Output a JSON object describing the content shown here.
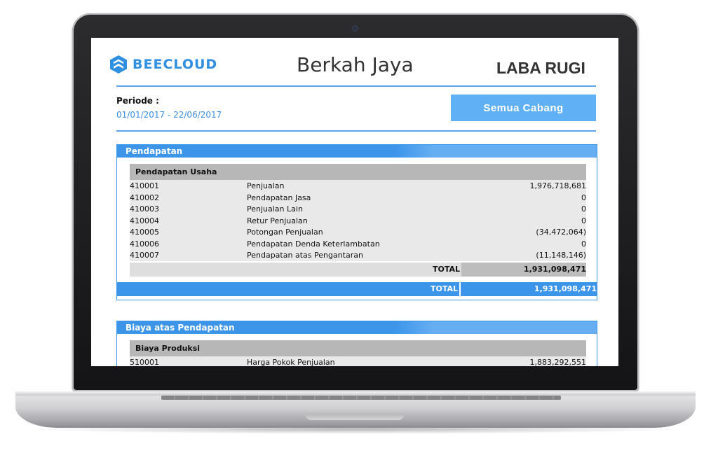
{
  "app": {
    "logo_text": "BEECLOUD",
    "company_name": "Berkah Jaya",
    "report_title": "LABA RUGI"
  },
  "period": {
    "label": "Periode :",
    "value": "01/01/2017 -  22/06/2017"
  },
  "branch_button": {
    "label": "Semua  Cabang"
  },
  "sections": [
    {
      "title": "Pendapatan",
      "group": {
        "title": "Pendapatan Usaha",
        "rows": [
          {
            "code": "410001",
            "name": "Penjualan",
            "amount": "1,976,718,681"
          },
          {
            "code": "410002",
            "name": "Pendapatan Jasa",
            "amount": "0"
          },
          {
            "code": "410003",
            "name": "Penjualan Lain",
            "amount": "0"
          },
          {
            "code": "410004",
            "name": "Retur Penjualan",
            "amount": "0"
          },
          {
            "code": "410005",
            "name": "Potongan Penjualan",
            "amount": "(34,472,064)"
          },
          {
            "code": "410006",
            "name": "Pendapatan Denda Keterlambatan",
            "amount": "0"
          },
          {
            "code": "410007",
            "name": "Pendapatan atas Pengantaran",
            "amount": "(11,148,146)"
          }
        ],
        "subtotal_label": "TOTAL",
        "subtotal_value": "1,931,098,471"
      },
      "total_label": "TOTAL",
      "total_value": "1,931,098,471"
    },
    {
      "title": "Biaya atas Pendapatan",
      "group": {
        "title": "Biaya Produksi",
        "rows": [
          {
            "code": "510001",
            "name": "Harga Pokok Penjualan",
            "amount": "1,883,292,551"
          }
        ]
      }
    }
  ],
  "colors": {
    "accent": "#3d95ea",
    "button": "#5fb0f5",
    "logo": "#2f8fe0"
  }
}
